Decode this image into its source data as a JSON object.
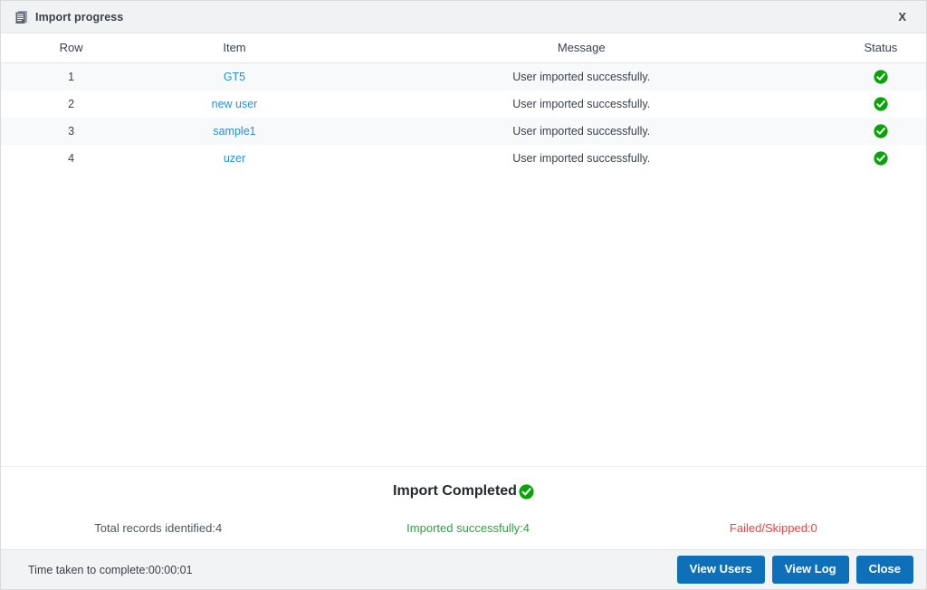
{
  "dialog": {
    "title": "Import progress",
    "title_icon": "document-icon",
    "close_label": "X"
  },
  "table": {
    "columns": [
      "Row",
      "Item",
      "Message",
      "Status"
    ],
    "rows": [
      {
        "row": "1",
        "item": "GT5",
        "message": "User imported successfully.",
        "status_icon": "success-check-icon"
      },
      {
        "row": "2",
        "item": "new user",
        "message": "User imported successfully.",
        "status_icon": "success-check-icon"
      },
      {
        "row": "3",
        "item": "sample1",
        "message": "User imported successfully.",
        "status_icon": "success-check-icon"
      },
      {
        "row": "4",
        "item": "uzer",
        "message": "User imported successfully.",
        "status_icon": "success-check-icon"
      }
    ]
  },
  "summary": {
    "title": "Import Completed",
    "title_icon": "success-check-icon",
    "total_records": "Total records identified:4",
    "imported_successfully": "Imported successfully:4",
    "failed_skipped": "Failed/Skipped:0"
  },
  "footer": {
    "time_taken": "Time taken to complete:00:00:01",
    "buttons": [
      {
        "label": "View Users"
      },
      {
        "label": "View Log"
      },
      {
        "label": "Close"
      }
    ]
  },
  "colors": {
    "accent_blue": "#0d70b9",
    "link_blue": "#2591d6",
    "success_green": "#2aa33f",
    "error_red": "#fd3a3a",
    "chrome_gray": "#f1f2f3"
  }
}
